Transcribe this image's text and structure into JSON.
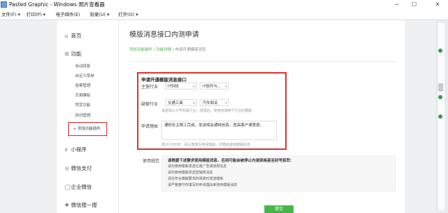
{
  "window": {
    "title": "Pasted Graphic - Windows 照片查看器",
    "controls": {
      "minimize": "─",
      "maximize": "☐",
      "close": "✕"
    }
  },
  "menu": [
    "文件(F) ▾",
    "打印(P) ▾",
    "电子邮件(E)",
    "刻录(U) ▾",
    "打开(O) ▾"
  ],
  "sidebar": {
    "home": {
      "icon": "⌂",
      "label": "首页"
    },
    "features": {
      "icon": "⊞",
      "label": "功能"
    },
    "feature_items": [
      "自动回复",
      "自定义菜单",
      "投票管理",
      "页面模板",
      "赞赏功能",
      "原创管理"
    ],
    "add_plugin": "+ 添加功能插件",
    "mini_program": {
      "icon": "∂",
      "label": "小程序"
    },
    "wechat_pay": {
      "icon": "◎",
      "label": "微信支付"
    },
    "enterprise": {
      "icon": "◯",
      "label": "企业微信"
    },
    "search": {
      "icon": "✱",
      "label": "微信搜一搜"
    }
  },
  "page": {
    "title": "模版消息接口内测申请",
    "breadcrumb": {
      "link1": "添加功能插件",
      "sep": " / ",
      "link2": "功能详情",
      "current": "申请开通模版消息"
    }
  },
  "form": {
    "section_title": "申请开通模版消息接口",
    "primary_industry": {
      "label": "主营行业",
      "options": [
        "IT科技",
        "IT软件与..."
      ]
    },
    "secondary_industry": {
      "label": "副营行业",
      "options": [
        "交通工具",
        "汽车相关"
      ],
      "hint": "请选择公众号所属行业。选择后，将使用该两个行业的模版"
    },
    "reason": {
      "label": "申请理由",
      "value": "通知车主随工完成，发送相关通知信息，提高客户满意度。",
      "hint": "限20-500字。请认真填写申请理由，并据此使用模版消息"
    }
  },
  "notice": {
    "label": "使用规范",
    "title": "请根据下述要求使用模版消息，否则可能会被停止内测资格甚至封号惩罚：",
    "items": [
      "请勿使用模板发送垃圾广告或违规信息",
      "请勿使用模版发送营销类消息",
      "请在符合模版要求的场景时发送模板",
      "请严格遵守你填写的申请理由来使用模版消息"
    ]
  },
  "submit_label": "提交",
  "colors": {
    "accent": "#44b549",
    "highlight": "#d93030"
  }
}
